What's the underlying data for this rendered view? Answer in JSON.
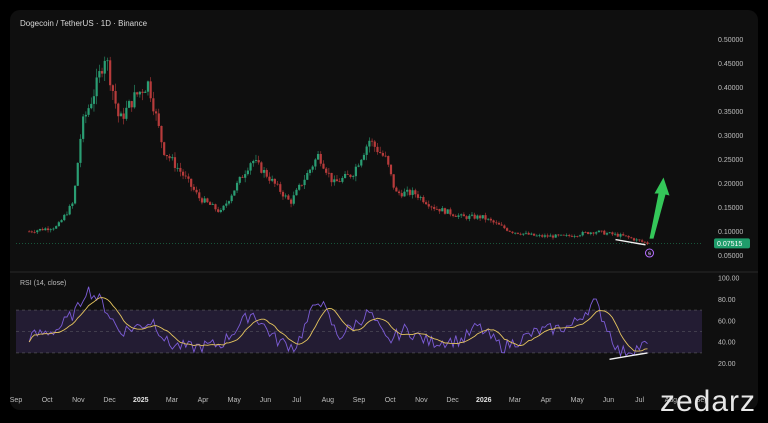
{
  "chart_data": [
    {
      "type": "candlestick",
      "title": "Dogecoin / TetherUS · 1D · Binance",
      "y_ticks": [
        "0.50000",
        "0.45000",
        "0.40000",
        "0.35000",
        "0.30000",
        "0.25000",
        "0.20000",
        "0.15000",
        "0.10000",
        "0.05000"
      ],
      "ylim": [
        0.03,
        0.52
      ],
      "current_price": "0.07515",
      "x_ticks": [
        "Sep",
        "Oct",
        "Nov",
        "Dec",
        "2025",
        "Mar",
        "Apr",
        "May",
        "Jun",
        "Jul",
        "Aug",
        "Sep",
        "Oct",
        "Nov",
        "Dec",
        "2026",
        "Mar",
        "Apr",
        "May",
        "Jun",
        "Jul",
        "Aug",
        "Sep"
      ],
      "series": [
        {
          "values": [
            {
              "x": "2024-09",
              "y": 0.1
            },
            {
              "x": "2024-10",
              "y": 0.11
            },
            {
              "x": "2024-11-01",
              "y": 0.16
            },
            {
              "x": "2024-11-10",
              "y": 0.32
            },
            {
              "x": "2024-11-25",
              "y": 0.4
            },
            {
              "x": "2024-12-05",
              "y": 0.47
            },
            {
              "x": "2024-12-20",
              "y": 0.33
            },
            {
              "x": "2025-01-05",
              "y": 0.38
            },
            {
              "x": "2025-01-20",
              "y": 0.41
            },
            {
              "x": "2025-02-05",
              "y": 0.27
            },
            {
              "x": "2025-02-25",
              "y": 0.22
            },
            {
              "x": "2025-03-15",
              "y": 0.17
            },
            {
              "x": "2025-04-07",
              "y": 0.14
            },
            {
              "x": "2025-05-10",
              "y": 0.25
            },
            {
              "x": "2025-05-25",
              "y": 0.22
            },
            {
              "x": "2025-06-20",
              "y": 0.16
            },
            {
              "x": "2025-07-20",
              "y": 0.26
            },
            {
              "x": "2025-08-05",
              "y": 0.2
            },
            {
              "x": "2025-08-25",
              "y": 0.22
            },
            {
              "x": "2025-09-12",
              "y": 0.29
            },
            {
              "x": "2025-09-30",
              "y": 0.25
            },
            {
              "x": "2025-10-10",
              "y": 0.18
            },
            {
              "x": "2025-10-30",
              "y": 0.18
            },
            {
              "x": "2025-11-20",
              "y": 0.15
            },
            {
              "x": "2025-12-20",
              "y": 0.13
            },
            {
              "x": "2026-01-10",
              "y": 0.13
            },
            {
              "x": "2026-02-10",
              "y": 0.1
            },
            {
              "x": "2026-03-10",
              "y": 0.09
            },
            {
              "x": "2026-04-10",
              "y": 0.09
            },
            {
              "x": "2026-05-10",
              "y": 0.1
            },
            {
              "x": "2026-06-10",
              "y": 0.09
            },
            {
              "x": "2026-07-05",
              "y": 0.075
            }
          ]
        }
      ]
    },
    {
      "type": "line",
      "title": "RSI (14, close)",
      "y_ticks": [
        "100.00",
        "80.00",
        "60.00",
        "40.00",
        "20.00"
      ],
      "ylim": [
        0,
        100
      ],
      "series": [
        {
          "values": [
            {
              "x": "2024-09",
              "y": 45
            },
            {
              "x": "2024-10",
              "y": 52
            },
            {
              "x": "2024-11-05",
              "y": 70
            },
            {
              "x": "2024-11-15",
              "y": 90
            },
            {
              "x": "2024-12-01",
              "y": 78
            },
            {
              "x": "2024-12-20",
              "y": 50
            },
            {
              "x": "2025-01-10",
              "y": 55
            },
            {
              "x": "2025-01-25",
              "y": 60
            },
            {
              "x": "2025-02-10",
              "y": 38
            },
            {
              "x": "2025-03-05",
              "y": 35
            },
            {
              "x": "2025-04-07",
              "y": 38
            },
            {
              "x": "2025-05-10",
              "y": 68
            },
            {
              "x": "2025-06-05",
              "y": 42
            },
            {
              "x": "2025-06-25",
              "y": 35
            },
            {
              "x": "2025-07-20",
              "y": 82
            },
            {
              "x": "2025-08-10",
              "y": 45
            },
            {
              "x": "2025-08-25",
              "y": 55
            },
            {
              "x": "2025-09-12",
              "y": 68
            },
            {
              "x": "2025-10-01",
              "y": 40
            },
            {
              "x": "2025-10-20",
              "y": 52
            },
            {
              "x": "2025-11-15",
              "y": 40
            },
            {
              "x": "2025-12-20",
              "y": 42
            },
            {
              "x": "2026-01-05",
              "y": 55
            },
            {
              "x": "2026-02-01",
              "y": 35
            },
            {
              "x": "2026-03-10",
              "y": 50
            },
            {
              "x": "2026-04-15",
              "y": 55
            },
            {
              "x": "2026-05-10",
              "y": 78
            },
            {
              "x": "2026-06-05",
              "y": 30
            },
            {
              "x": "2026-06-25",
              "y": 35
            },
            {
              "x": "2026-07-05",
              "y": 38
            }
          ]
        }
      ]
    }
  ],
  "watermark": "zedarz",
  "marker_label": "ꞩ",
  "colors": {
    "up": "#2a9d73",
    "down": "#b73b3b",
    "rsi_line": "#7c5cd6",
    "rsi_ma": "#e4c45e",
    "rsi_band": "#2b2240",
    "arrow": "#34c759",
    "price_line": "#1f7f55"
  }
}
